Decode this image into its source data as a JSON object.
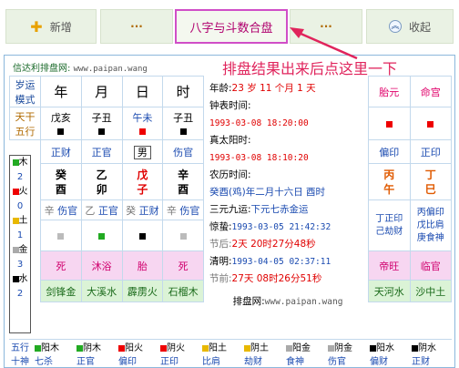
{
  "toolbar": {
    "add": "新增",
    "dots1": "···",
    "main": "八字与斗数合盘",
    "dots2": "···",
    "collapse": "收起"
  },
  "note": "排盘结果出来后点这里一下",
  "site": {
    "name": "信达利排盘网:",
    "url": "www.paipan.wang"
  },
  "grid": {
    "corner1": "岁运",
    "corner2": "模式",
    "heads": [
      "年",
      "月",
      "日",
      "时"
    ],
    "tiangan_label": "天干",
    "wuxing_label": "五行",
    "gods_top": [
      "戊亥",
      "子丑",
      "午未",
      "子丑"
    ],
    "ten_gods": [
      "正财",
      "正官",
      "男",
      "伤官"
    ],
    "stems": [
      "癸",
      "乙",
      "戊",
      "辛"
    ],
    "branches": [
      "酉",
      "卯",
      "子",
      "酉"
    ],
    "hidden": [
      [
        "辛",
        "伤官"
      ],
      [
        "乙",
        "正官"
      ],
      [
        "癸",
        "正财"
      ],
      [
        "辛",
        "伤官"
      ]
    ],
    "phase": [
      "死",
      "沐浴",
      "胎",
      "死"
    ],
    "nayin": [
      "剑锋金",
      "大溪水",
      "霹雳火",
      "石榴木"
    ]
  },
  "wuxing": [
    {
      "n": "木",
      "c": "2"
    },
    {
      "n": "火",
      "c": "0"
    },
    {
      "n": "土",
      "c": "1"
    },
    {
      "n": "金",
      "c": "3"
    },
    {
      "n": "水",
      "c": "2"
    }
  ],
  "info": {
    "age": "年龄:",
    "age_v": "23 岁 11 个月 1 天",
    "clock": "钟表时间:",
    "clock_v": "1993-03-08 18:20:00",
    "solar": "真太阳时:",
    "solar_v": "1993-03-08 18:10:20",
    "lunar": "农历时间:",
    "lunar_v": "癸酉(鸡)年二月十六日 酉时",
    "sanyuan": "三元九运:",
    "sanyuan_v": "下元七赤金运",
    "jingzhe": "惊蛰:",
    "jingzhe_v": "1993-03-05 21:42:32",
    "before": "节后:",
    "before_v": "2天 20时27分48秒",
    "qingming": "清明:",
    "qingming_v": "1993-04-05 02:37:11",
    "after": "节前:",
    "after_v": "27天 08时26分51秒",
    "site2": "排盘网:",
    "site2_v": "www.paipan.wang"
  },
  "right": {
    "heads": [
      "胎元",
      "命宫"
    ],
    "gods": [
      "偏印",
      "正印"
    ],
    "stems": [
      "丙",
      "丁"
    ],
    "branches": [
      "午",
      "巳"
    ],
    "hid1": [
      "丁正印",
      "丙偏印"
    ],
    "hid2": [
      "己劫财",
      "戊比肩"
    ],
    "hid3": [
      "",
      "庚食神"
    ],
    "phase": [
      "帝旺",
      "临官"
    ],
    "nayin": [
      "天河水",
      "沙中土"
    ]
  },
  "bottom": [
    {
      "a": "阳木",
      "b": "七杀"
    },
    {
      "a": "阴木",
      "b": "正官"
    },
    {
      "a": "阳火",
      "b": "偏印"
    },
    {
      "a": "阴火",
      "b": "正印"
    },
    {
      "a": "阳土",
      "b": "比肩"
    },
    {
      "a": "阴土",
      "b": "劫财"
    },
    {
      "a": "阳金",
      "b": "食神"
    },
    {
      "a": "阴金",
      "b": "伤官"
    },
    {
      "a": "阳水",
      "b": "偏财"
    },
    {
      "a": "阴水",
      "b": "正财"
    }
  ],
  "bottom_label": [
    "五行",
    "十神"
  ]
}
